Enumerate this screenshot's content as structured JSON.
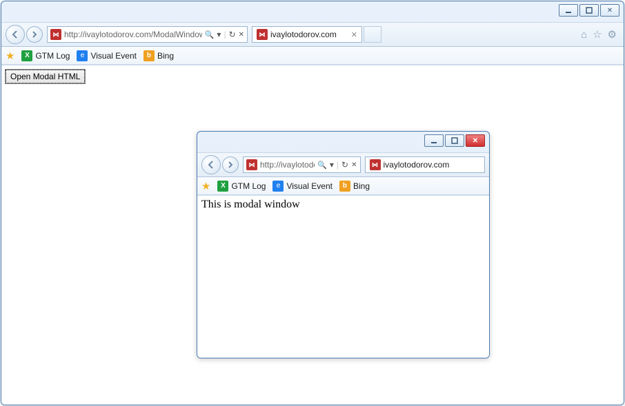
{
  "main": {
    "url": "http://ivaylotodorov.com/ModalWindow/ModalBu",
    "tab_title": "ivaylotodorov.com",
    "button_label": "Open Modal HTML"
  },
  "modal": {
    "url": "http://ivaylotodo...",
    "tab_title": "ivaylotodorov.com",
    "body_text": "This is modal window"
  },
  "bookmarks": {
    "gtm": "GTM Log",
    "visual": "Visual Event",
    "bing": "Bing"
  },
  "glyphs": {
    "search": "🔍",
    "dropdown": "▾",
    "refresh": "↻",
    "stop": "✕",
    "home": "⌂",
    "star": "☆",
    "gear": "⚙",
    "close_tab": "✕",
    "favicon": "⋈",
    "ie": "e",
    "bing": "b",
    "gtm": "X",
    "fav_star": "★",
    "close_x": "✕"
  }
}
